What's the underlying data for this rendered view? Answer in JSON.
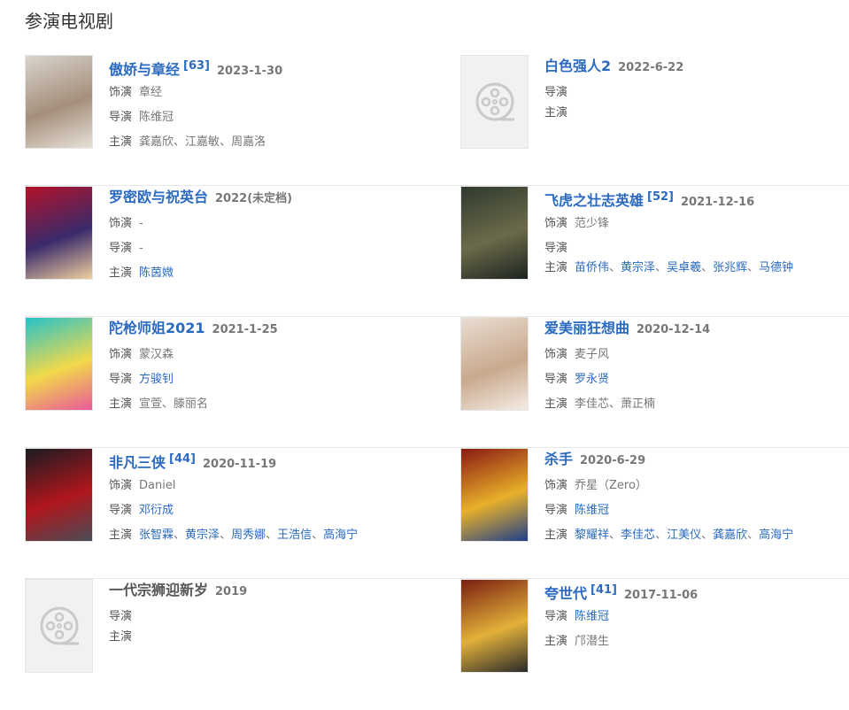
{
  "heading": "参演电视剧",
  "labels": {
    "role": "饰演",
    "director": "导演",
    "cast": "主演"
  },
  "shows": [
    {
      "title": "傲娇与章经",
      "score": "[63]",
      "date": "2023-1-30",
      "role": "章经",
      "director": [
        "陈维冠"
      ],
      "director_link": false,
      "cast": [
        "龚嘉欣",
        "江嘉敏",
        "周嘉洛"
      ],
      "cast_link": false,
      "poster": "poster-1",
      "colors": [
        "#d9d4cc",
        "#a58f7c",
        "#e7e1d8"
      ]
    },
    {
      "title": "白色强人2",
      "score": "",
      "date": "2022-6-22",
      "role": null,
      "director": [],
      "cast": [],
      "poster": "placeholder"
    },
    {
      "title": "罗密欧与祝英台",
      "score": "",
      "date": "2022(未定档)",
      "role": "-",
      "director": [
        "-"
      ],
      "director_link": false,
      "cast": [
        "陈茵媺"
      ],
      "cast_link": true,
      "poster": "poster-3",
      "colors": [
        "#b3122a",
        "#3a2a6a",
        "#f0d0a0"
      ]
    },
    {
      "title": "飞虎之壮志英雄",
      "score": "[52]",
      "date": "2021-12-16",
      "role": "范少锋",
      "director": [],
      "cast": [
        "苗侨伟",
        "黄宗泽",
        "吴卓羲",
        "张兆辉",
        "马德钟"
      ],
      "cast_link": true,
      "poster": "poster-4",
      "colors": [
        "#2f3a2e",
        "#6b6a4a",
        "#1d2420"
      ]
    },
    {
      "title": "陀枪师姐2021",
      "score": "",
      "date": "2021-1-25",
      "role": "蒙汉森",
      "director": [
        "方骏钊"
      ],
      "director_link": true,
      "cast": [
        "宣萱",
        "滕丽名"
      ],
      "cast_link": false,
      "poster": "poster-5",
      "colors": [
        "#27c2c8",
        "#f2d94a",
        "#e85a9a"
      ]
    },
    {
      "title": "爱美丽狂想曲",
      "score": "",
      "date": "2020-12-14",
      "role": "麦子风",
      "director": [
        "罗永贤"
      ],
      "director_link": true,
      "cast": [
        "李佳芯",
        "萧正楠"
      ],
      "cast_link": false,
      "poster": "poster-6",
      "colors": [
        "#e9ddd2",
        "#c9a98e",
        "#f4ece4"
      ]
    },
    {
      "title": "非凡三侠",
      "score": "[44]",
      "date": "2020-11-19",
      "role": "Daniel",
      "director": [
        "邓衍成"
      ],
      "director_link": true,
      "cast": [
        "张智霖",
        "黄宗泽",
        "周秀娜",
        "王浩信",
        "高海宁"
      ],
      "cast_link": true,
      "poster": "poster-7",
      "colors": [
        "#1a1c22",
        "#b0161c",
        "#4a4c56"
      ]
    },
    {
      "title": "杀手",
      "score": "",
      "date": "2020-6-29",
      "role": "乔星（Zero）",
      "director": [
        "陈维冠"
      ],
      "director_link": true,
      "cast": [
        "黎耀祥",
        "李佳芯",
        "江美仪",
        "龚嘉欣",
        "高海宁"
      ],
      "cast_link": true,
      "poster": "poster-8",
      "colors": [
        "#8a1a12",
        "#e8b02a",
        "#1f3f8a"
      ]
    },
    {
      "title": "一代宗狮迎新岁",
      "score": "",
      "date": "2019",
      "role": null,
      "director": [],
      "cast": [],
      "poster": "placeholder",
      "nolink": true
    },
    {
      "title": "夸世代",
      "score": "[41]",
      "date": "2017-11-06",
      "role": null,
      "director": [
        "陈维冠"
      ],
      "director_link": true,
      "cast": [
        "邝潜生"
      ],
      "cast_link": false,
      "poster": "poster-10",
      "colors": [
        "#7a1e10",
        "#e3b13a",
        "#2a2a2a"
      ]
    }
  ]
}
